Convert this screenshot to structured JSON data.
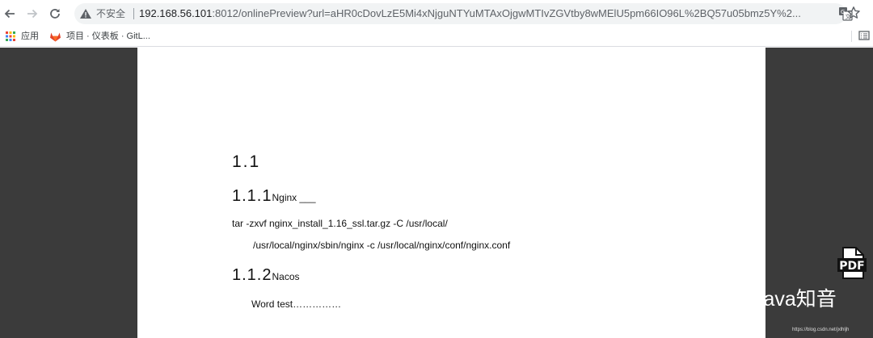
{
  "browser": {
    "security_label": "不安全",
    "url_host": "192.168.56.101",
    "url_rest": ":8012/onlinePreview?url=aHR0cDovLzE5Mi4xNjguNTYuMTAxOjgwMTIvZGVtby8wMElU5pm66IO96L%2BQ57u05bmz5Y%2..."
  },
  "bookmarks": {
    "apps_label": "应用",
    "gitlab_label": "项目 · 仪表板 · GitL..."
  },
  "document": {
    "heading_1": "1.1",
    "section_1": {
      "number": "1.1.1",
      "title": "Nginx ___"
    },
    "line_1": "tar -zxvf nginx_install_1.16_ssl.tar.gz -C /usr/local/",
    "line_2": "/usr/local/nginx/sbin/nginx -c /usr/local/nginx/conf/nginx.conf",
    "section_2": {
      "number": "1.1.2",
      "title": "Nacos"
    },
    "line_3": "Word test……………"
  },
  "viewer": {
    "pdf_button_label": "PDF"
  },
  "watermark": {
    "name": "Java知音",
    "small": "https://blog.csdn.net/jxlhljh"
  },
  "colors": {
    "viewer_background": "#3b3b3b",
    "page_background": "#ffffff",
    "gitlab_orange": "#e24329"
  }
}
